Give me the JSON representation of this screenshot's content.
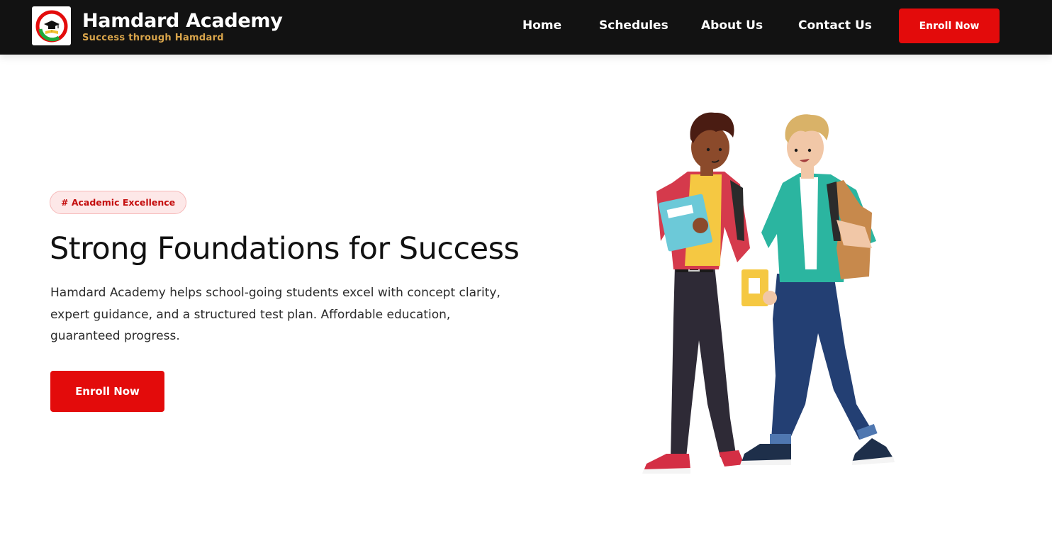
{
  "header": {
    "logo_icon": "graduation-cap-book-logo",
    "brand_title": "Hamdard Academy",
    "tagline": "Success through Hamdard",
    "nav": [
      {
        "label": "Home"
      },
      {
        "label": "Schedules"
      },
      {
        "label": "About Us"
      },
      {
        "label": "Contact Us"
      }
    ],
    "enroll_label": "Enroll Now"
  },
  "hero": {
    "badge": "# Academic Excellence",
    "title": "Strong Foundations for Success",
    "description": "Hamdard Academy helps school-going students excel with concept clarity, expert guidance, and a structured test plan. Affordable education, guaranteed progress.",
    "cta_label": "Enroll Now",
    "illustration_icon": "two-students-walking-illustration"
  },
  "colors": {
    "header_bg": "#121212",
    "accent_red": "#e30b0b",
    "tagline_gold": "#d9a54b",
    "badge_bg": "#fde8e8",
    "badge_text": "#c40d0d"
  }
}
